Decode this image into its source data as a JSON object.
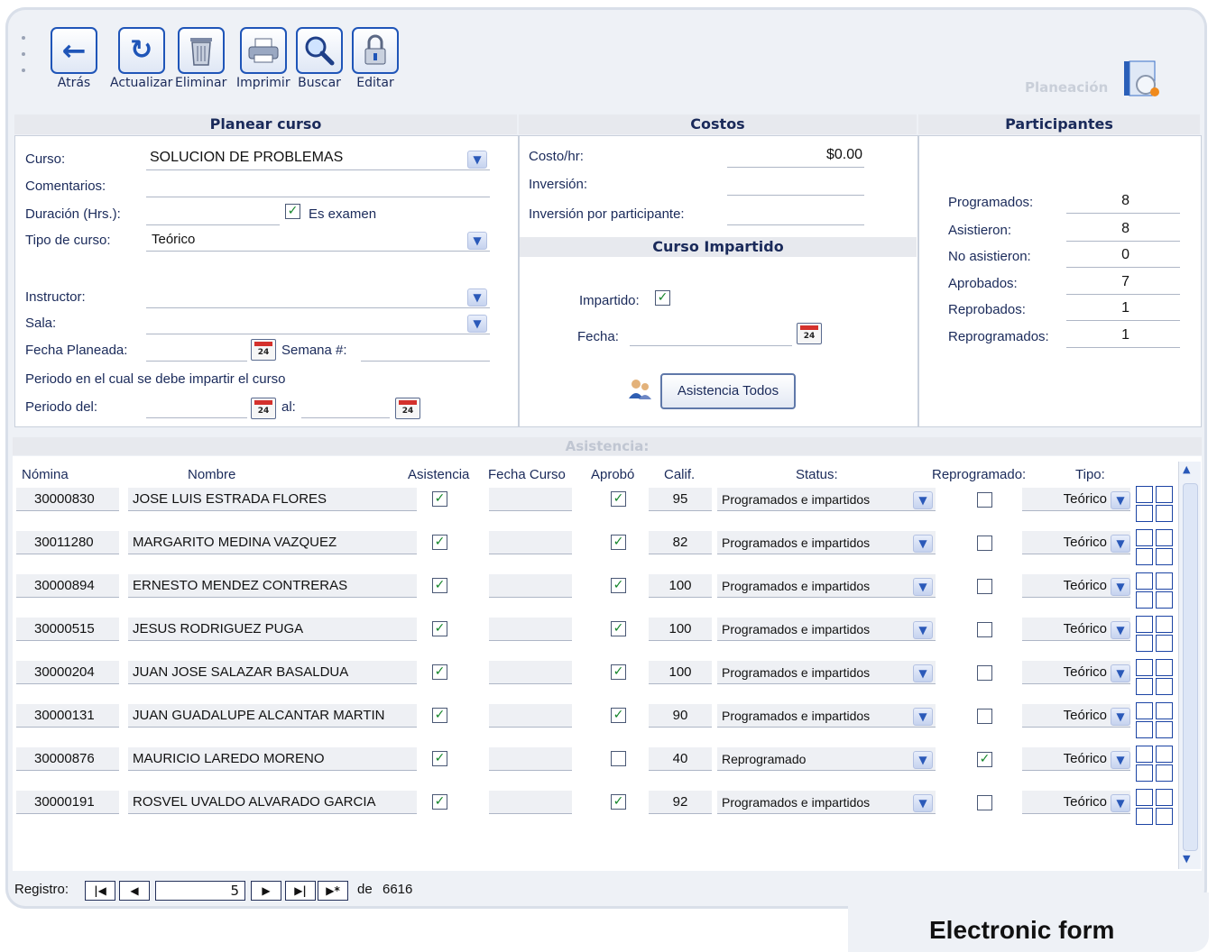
{
  "toolbar": {
    "buttons": [
      {
        "label": "Atrás",
        "icon": "back-arrow-icon"
      },
      {
        "label": "Actualizar",
        "icon": "refresh-icon"
      },
      {
        "label": "Eliminar",
        "icon": "trash-icon"
      },
      {
        "label": "Imprimir",
        "icon": "printer-icon"
      },
      {
        "label": "Buscar",
        "icon": "magnifier-icon"
      },
      {
        "label": "Editar",
        "icon": "lock-edit-icon"
      }
    ],
    "module_label": "Planeación"
  },
  "planear": {
    "header": "Planear curso",
    "curso_label": "Curso:",
    "curso_value": "SOLUCION DE PROBLEMAS",
    "comentarios_label": "Comentarios:",
    "duracion_label": "Duración (Hrs.):",
    "es_examen_label": "Es examen",
    "es_examen_checked": true,
    "tipo_label": "Tipo de curso:",
    "tipo_value": "Teórico",
    "instructor_label": "Instructor:",
    "sala_label": "Sala:",
    "fecha_planeada_label": "Fecha Planeada:",
    "semana_label": "Semana #:",
    "periodo_text": "Periodo en el cual se debe impartir el curso",
    "periodo_del_label": "Periodo del:",
    "al_label": "al:",
    "cal_glyph": "24"
  },
  "costos": {
    "header": "Costos",
    "costo_hr_label": "Costo/hr:",
    "costo_hr_value": "$0.00",
    "inversion_label": "Inversión:",
    "inversion_part_label": "Inversión por participante:"
  },
  "impartido": {
    "header": "Curso Impartido",
    "impartido_label": "Impartido:",
    "impartido_checked": true,
    "fecha_label": "Fecha:",
    "asistencia_todos_label": "Asistencia Todos"
  },
  "participantes": {
    "header": "Participantes",
    "rows": [
      {
        "label": "Programados:",
        "value": "8"
      },
      {
        "label": "Asistieron:",
        "value": "8"
      },
      {
        "label": "No asistieron:",
        "value": "0"
      },
      {
        "label": "Aprobados:",
        "value": "7"
      },
      {
        "label": "Reprobados:",
        "value": "1"
      },
      {
        "label": "Reprogramados:",
        "value": "1"
      }
    ]
  },
  "asistencia": {
    "header": "Asistencia:",
    "columns": {
      "nomina": "Nómina",
      "nombre": "Nombre",
      "asistencia": "Asistencia",
      "fecha_curso": "Fecha Curso",
      "aprobo": "Aprobó",
      "calif": "Calif.",
      "status": "Status:",
      "reprogramado": "Reprogramado:",
      "tipo": "Tipo:"
    },
    "rows": [
      {
        "nomina": "30000830",
        "nombre": "JOSE LUIS ESTRADA FLORES",
        "asistencia": true,
        "aprobo": true,
        "calif": "95",
        "status": "Programados e impartidos",
        "reprogramado": false,
        "tipo": "Teórico"
      },
      {
        "nomina": "30011280",
        "nombre": "MARGARITO MEDINA VAZQUEZ",
        "asistencia": true,
        "aprobo": true,
        "calif": "82",
        "status": "Programados e impartidos",
        "reprogramado": false,
        "tipo": "Teórico"
      },
      {
        "nomina": "30000894",
        "nombre": "ERNESTO MENDEZ CONTRERAS",
        "asistencia": true,
        "aprobo": true,
        "calif": "100",
        "status": "Programados e impartidos",
        "reprogramado": false,
        "tipo": "Teórico"
      },
      {
        "nomina": "30000515",
        "nombre": "JESUS RODRIGUEZ PUGA",
        "asistencia": true,
        "aprobo": true,
        "calif": "100",
        "status": "Programados e impartidos",
        "reprogramado": false,
        "tipo": "Teórico"
      },
      {
        "nomina": "30000204",
        "nombre": "JUAN JOSE SALAZAR BASALDUA",
        "asistencia": true,
        "aprobo": true,
        "calif": "100",
        "status": "Programados e impartidos",
        "reprogramado": false,
        "tipo": "Teórico"
      },
      {
        "nomina": "30000131",
        "nombre": "JUAN GUADALUPE ALCANTAR MARTIN",
        "asistencia": true,
        "aprobo": true,
        "calif": "90",
        "status": "Programados e impartidos",
        "reprogramado": false,
        "tipo": "Teórico"
      },
      {
        "nomina": "30000876",
        "nombre": "MAURICIO LAREDO MORENO",
        "asistencia": true,
        "aprobo": false,
        "calif": "40",
        "status": "Reprogramado",
        "reprogramado": true,
        "tipo": "Teórico"
      },
      {
        "nomina": "30000191",
        "nombre": "ROSVEL UVALDO ALVARADO GARCIA",
        "asistencia": true,
        "aprobo": true,
        "calif": "92",
        "status": "Programados e impartidos",
        "reprogramado": false,
        "tipo": "Teórico"
      }
    ]
  },
  "record_nav": {
    "label": "Registro:",
    "current": "5",
    "of_label": "de",
    "total": "6616"
  },
  "caption": "Electronic form",
  "colors": {
    "accent": "#1f55b8",
    "check": "#14852a",
    "calendar_red": "#d4312c"
  }
}
